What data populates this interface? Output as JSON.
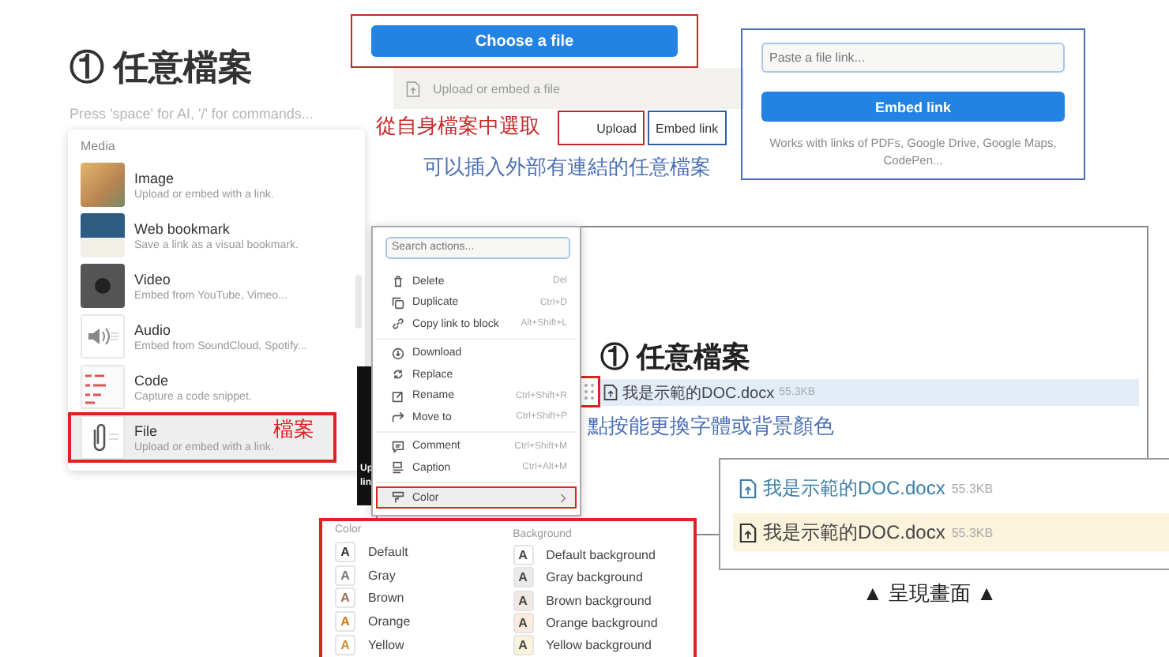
{
  "left_panel": {
    "title": "① 任意檔案",
    "hint": "Press 'space' for AI, '/' for commands...",
    "section": "Media",
    "items": [
      {
        "kind": "image",
        "name": "Image",
        "description": "Upload or embed with a link.",
        "selected": false
      },
      {
        "kind": "bookmark",
        "name": "Web bookmark",
        "description": "Save a link as a visual bookmark.",
        "selected": false
      },
      {
        "kind": "video",
        "name": "Video",
        "description": "Embed from YouTube, Vimeo...",
        "selected": false
      },
      {
        "kind": "audio",
        "name": "Audio",
        "description": "Embed from SoundCloud, Spotify...",
        "selected": false
      },
      {
        "kind": "code",
        "name": "Code",
        "description": "Capture a code snippet.",
        "selected": false
      },
      {
        "kind": "file",
        "name": "File",
        "description": "Upload or embed with a link.",
        "selected": true
      }
    ],
    "annotation": "檔案"
  },
  "upload_panel": {
    "button": "Choose a file",
    "row": "Upload or embed a file",
    "tabs": [
      {
        "label": "Upload",
        "color": "#c62828"
      },
      {
        "label": "Embed link",
        "color": "#2f5fa8"
      }
    ],
    "annotations": [
      {
        "text": "從自身檔案中選取",
        "color": "#c62828"
      },
      {
        "text": "可以插入外部有連結的任意檔案",
        "color": "#4a6fb5"
      }
    ]
  },
  "embed_panel": {
    "placeholder": "Paste a file link...",
    "button": "Embed link",
    "note": "Works with links of PDFs, Google Drive, Google Maps, CodePen..."
  },
  "preview": {
    "title": "① 任意檔案",
    "file": {
      "name": "我是示範的DOC.docx",
      "size": "55.3KB",
      "selected": true
    },
    "annotation": "點按能更換字體或背景顏色"
  },
  "side_fragment": [
    "Up",
    "lin"
  ],
  "actions_menu": {
    "placeholder": "Search actions...",
    "groups": [
      {
        "items": [
          {
            "label": "Delete",
            "shortcut": "Del",
            "selected": false
          },
          {
            "label": "Duplicate",
            "shortcut": "Ctrl+D",
            "selected": false
          },
          {
            "label": "Copy link to block",
            "shortcut": "Alt+Shift+L",
            "selected": false
          }
        ]
      },
      {
        "items": [
          {
            "label": "Download",
            "selected": false
          },
          {
            "label": "Replace",
            "selected": false
          },
          {
            "label": "Rename",
            "shortcut": "Ctrl+Shift+R",
            "selected": false
          },
          {
            "label": "Move to",
            "shortcut": "Ctrl+Shift+P",
            "selected": false
          }
        ]
      },
      {
        "items": [
          {
            "label": "Comment",
            "shortcut": "Ctrl+Shift+M",
            "selected": false
          },
          {
            "label": "Caption",
            "shortcut": "Ctrl+Alt+M",
            "selected": false
          }
        ]
      },
      {
        "items": [
          {
            "label": "Color",
            "selected": true
          }
        ]
      }
    ]
  },
  "color_menu": {
    "color_heading": "Color",
    "background_heading": "Background",
    "colors": [
      {
        "swatch": "A",
        "label": "Default",
        "color": "#37352f"
      },
      {
        "swatch": "A",
        "label": "Gray",
        "color": "#787774"
      },
      {
        "swatch": "A",
        "label": "Brown",
        "color": "#9f6b53"
      },
      {
        "swatch": "A",
        "label": "Orange",
        "color": "#d9730d"
      },
      {
        "swatch": "A",
        "label": "Yellow",
        "color": "#cb912f"
      }
    ],
    "backgrounds": [
      {
        "swatch": "A",
        "label": "Default background",
        "color": "#ffffff"
      },
      {
        "swatch": "A",
        "label": "Gray background",
        "color": "#ebebea"
      },
      {
        "swatch": "A",
        "label": "Brown background",
        "color": "#f1e8e4"
      },
      {
        "swatch": "A",
        "label": "Orange background",
        "color": "#fbecdd"
      },
      {
        "swatch": "A",
        "label": "Yellow background",
        "color": "#fbf3db"
      }
    ]
  },
  "result": {
    "files": [
      {
        "kind": "text",
        "name": "我是示範的DOC.docx",
        "size": "55.3KB",
        "color": "#3b7ea8"
      },
      {
        "kind": "background",
        "name": "我是示範的DOC.docx",
        "size": "55.3KB",
        "color": "#fbf3db"
      }
    ],
    "caption": "▲ 呈現畫面 ▲"
  }
}
